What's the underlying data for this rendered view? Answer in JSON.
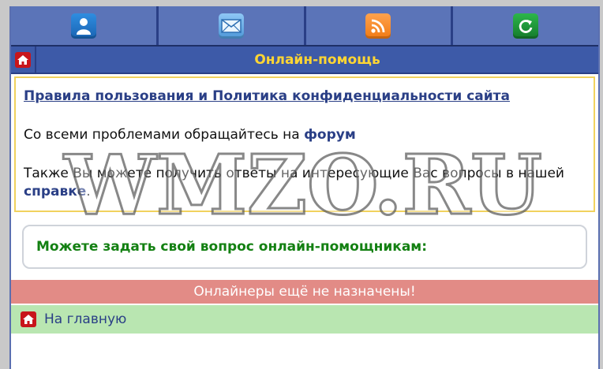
{
  "topbar": {
    "icons": [
      "user-icon",
      "mail-icon",
      "rss-icon",
      "refresh-icon"
    ]
  },
  "header": {
    "title": "Онлайн-помощь"
  },
  "info": {
    "rules_link": "Правила пользования и Политика конфиденциальности сайта",
    "line1_prefix": "Со всеми проблемами обращайтесь на ",
    "forum_link": "форум",
    "line2_prefix": "Также Вы можете получить ответы на интересующие Вас вопросы в нашей ",
    "help_link": "справке",
    "line2_suffix": "."
  },
  "ask": {
    "text": "Можете задать свой вопрос онлайн-помощникам:"
  },
  "status": {
    "text": "Онлайнеры ещё не назначены!"
  },
  "footer": {
    "home_label": "На главную"
  },
  "watermark": {
    "text": "WMZO.RU"
  },
  "colors": {
    "title": "#ffd633",
    "header_bg": "#3d5aa8",
    "status_bg": "#e28b86",
    "footer_bg": "#b9e6b1",
    "ask_text": "#138012"
  }
}
